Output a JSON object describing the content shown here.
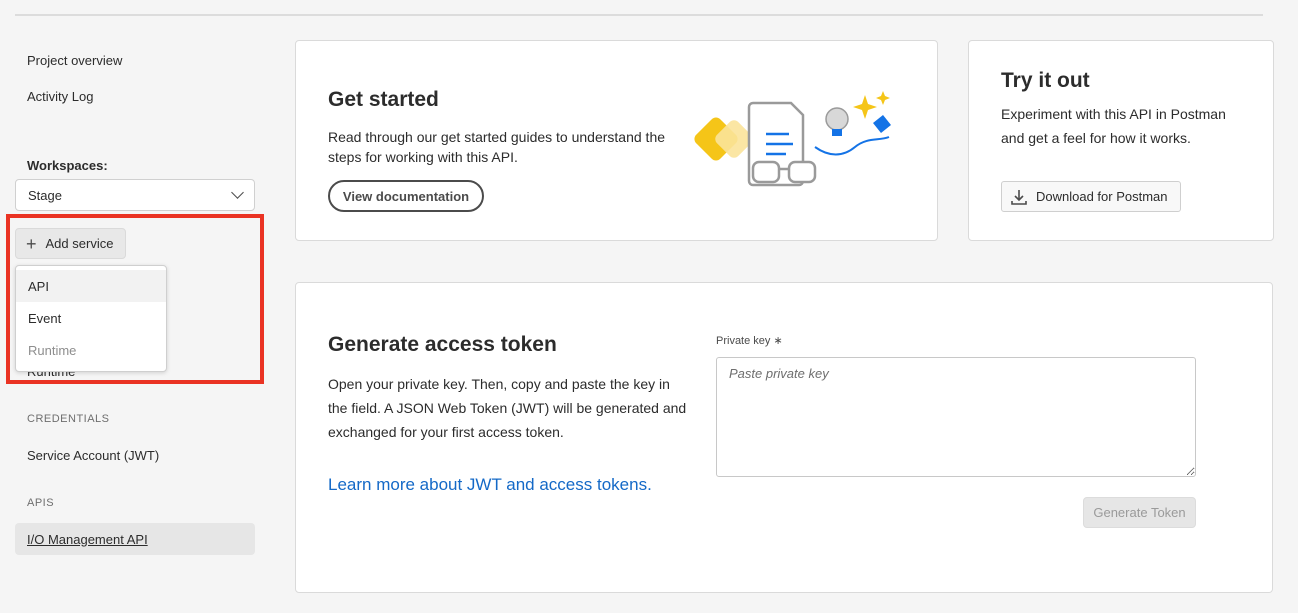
{
  "sidebar": {
    "nav": [
      "Project overview",
      "Activity Log"
    ],
    "workspaces_label": "Workspaces:",
    "workspace_selected": "Stage",
    "add_service_label": "Add service",
    "service_menu": [
      {
        "label": "API",
        "state": "hover"
      },
      {
        "label": "Event",
        "state": "normal"
      },
      {
        "label": "Runtime",
        "state": "disabled"
      }
    ],
    "hidden_item": "Runtime",
    "credentials_heading": "CREDENTIALS",
    "credentials_item": "Service Account (JWT)",
    "apis_heading": "APIS",
    "apis_item": "I/O Management API"
  },
  "get_started": {
    "title": "Get started",
    "body": "Read through our get started guides to understand the steps for working with this API.",
    "button": "View documentation"
  },
  "try_it": {
    "title": "Try it out",
    "body": "Experiment with this API in Postman and get a feel for how it works.",
    "button": "Download for Postman",
    "icon": "download-icon"
  },
  "token": {
    "title": "Generate access token",
    "body": "Open your private key. Then, copy and paste the key in the field. A JSON Web Token (JWT) will be generated and exchanged for your first access token.",
    "link": "Learn more about JWT and access tokens.",
    "field_label": "Private key",
    "required_mark": "∗",
    "placeholder": "Paste private key",
    "button": "Generate Token"
  },
  "colors": {
    "highlight": "#ea3323",
    "link": "#1469c7"
  }
}
